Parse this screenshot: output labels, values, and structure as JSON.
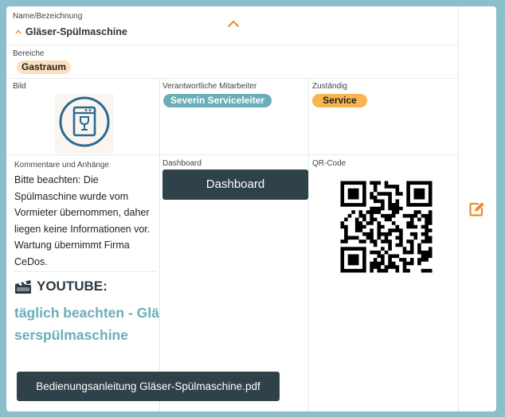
{
  "name_field": {
    "label": "Name/Bezeichnung",
    "value": "Gläser-Spülmaschine"
  },
  "bereiche": {
    "label": "Bereiche",
    "tag": "Gastraum",
    "tag_color": "#fde1bf"
  },
  "bild": {
    "label": "Bild",
    "icon": "dishwasher-icon"
  },
  "mitarbeiter": {
    "label": "Verantwortliche Mitarbeiter",
    "tag": "Severin Serviceleiter",
    "tag_color": "#6aaeba"
  },
  "zustaendig": {
    "label": "Zuständig",
    "tag": "Service",
    "tag_color": "#f8b54e"
  },
  "kommentare": {
    "label": "Kommentare und Anhänge",
    "text": "Bitte beachten: Die Spülmaschine wurde vom Vormieter übernommen, daher liegen keine Informationen vor. Wartung übernimmt Firma CeDos.",
    "youtube_icon": "clapper-icon",
    "youtube_title": "YOUTUBE:",
    "youtube_link": "täglich beachten - Gläserspülmaschine",
    "attachment": "Bedienungsanleitung Gläser-Spülmaschine.pdf"
  },
  "dashboard": {
    "label": "Dashboard",
    "button": "Dashboard"
  },
  "qr": {
    "label": "QR-Code",
    "icon": "qr-code-icon"
  },
  "actions": {
    "collapse_icon": "chevron-up-icon",
    "edit_icon": "edit-icon"
  },
  "colors": {
    "accent": "#f08a24",
    "dark": "#2f4149",
    "link": "#6aaeba",
    "icon_blue": "#2b6a8d"
  }
}
